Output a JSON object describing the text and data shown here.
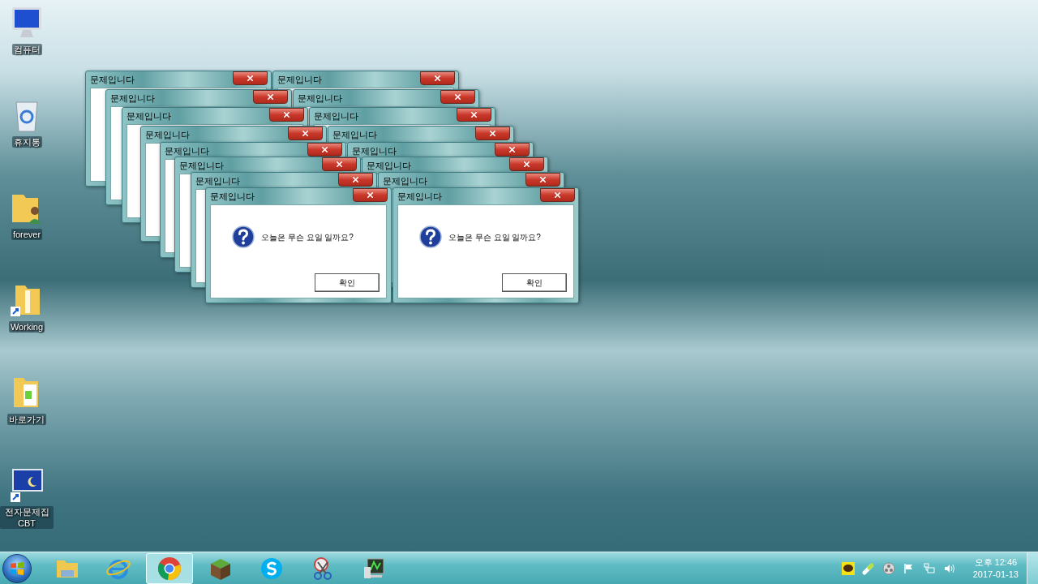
{
  "desktop_icons": [
    {
      "label": "컴퓨터"
    },
    {
      "label": "휴지통"
    },
    {
      "label": "forever"
    },
    {
      "label": "Working"
    },
    {
      "label": "바로가기"
    },
    {
      "label": "전자문제집 CBT"
    }
  ],
  "dialogs": [
    {
      "title": "문제입니다"
    },
    {
      "title": "문제입니다"
    },
    {
      "title": "문제입니다"
    },
    {
      "title": "문제입니다"
    },
    {
      "title": "문제입니다"
    },
    {
      "title": "문제입니다"
    },
    {
      "title": "문제입니다"
    },
    {
      "title": "문제입니다"
    },
    {
      "title": "문제입니다"
    },
    {
      "title": "문제입니다"
    },
    {
      "title": "문제입니다"
    },
    {
      "title": "문제입니다"
    },
    {
      "title": "문제입니다"
    },
    {
      "title": "문제입니다"
    },
    {
      "title": "문제입니다",
      "message": "오늘은 무슨 요일 일까요?",
      "button": "확인"
    },
    {
      "title": "문제입니다",
      "message": "오늘은 무슨 요일 일까요?",
      "button": "확인"
    }
  ],
  "taskbar": {
    "apps": [
      {
        "selected": false
      },
      {
        "selected": false
      },
      {
        "selected": true
      },
      {
        "selected": false
      },
      {
        "selected": false
      },
      {
        "selected": false
      },
      {
        "selected": false
      }
    ],
    "clock": {
      "time": "오후 12:46",
      "date": "2017-01-13"
    }
  }
}
